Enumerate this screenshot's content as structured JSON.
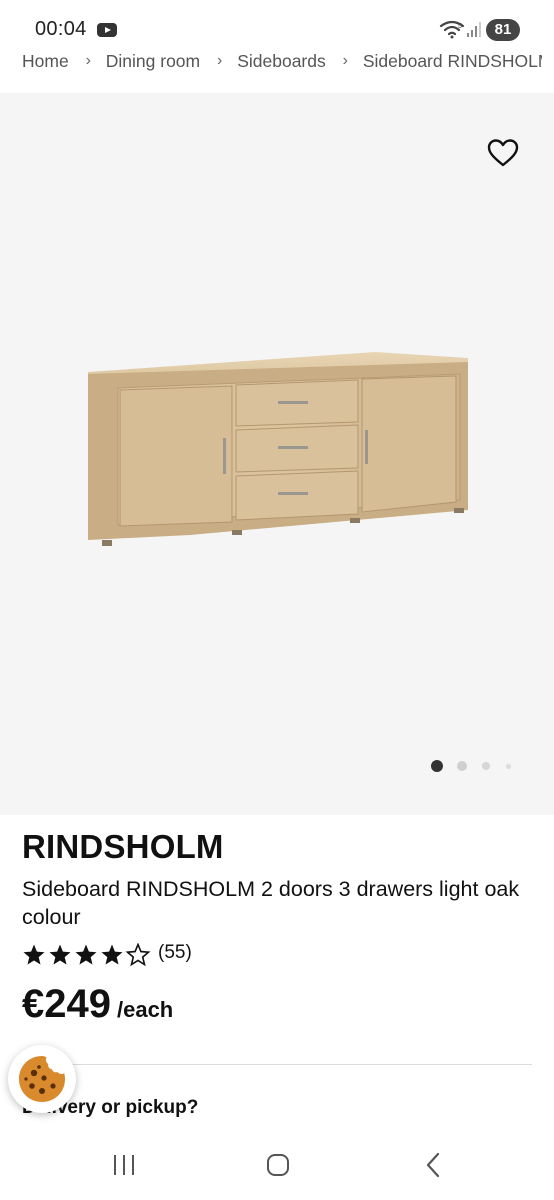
{
  "status_bar": {
    "time": "00:04",
    "battery": "81",
    "icons": [
      "youtube-icon",
      "wifi-icon",
      "signal-icon",
      "battery-icon"
    ]
  },
  "breadcrumb": {
    "items": [
      "Home",
      "Dining room",
      "Sideboards",
      "Sideboard RINDSHOLM"
    ],
    "separator": "›"
  },
  "gallery": {
    "wishlist_icon": "heart-outline-icon",
    "dot_count": 4,
    "active_dot": 0,
    "background_color": "#f5f5f5"
  },
  "product": {
    "brand": "RINDSHOLM",
    "description": "Sideboard RINDSHOLM 2 doors 3 drawers light oak colour",
    "rating": 4.5,
    "rating_count": "(55)",
    "price": "€249",
    "price_unit": "/each",
    "delivery_heading": "Delivery or pickup?"
  },
  "cookie": {
    "icon": "cookie-icon"
  },
  "nav_bar": {
    "icons": [
      "recent-apps-icon",
      "home-icon",
      "back-icon"
    ]
  }
}
